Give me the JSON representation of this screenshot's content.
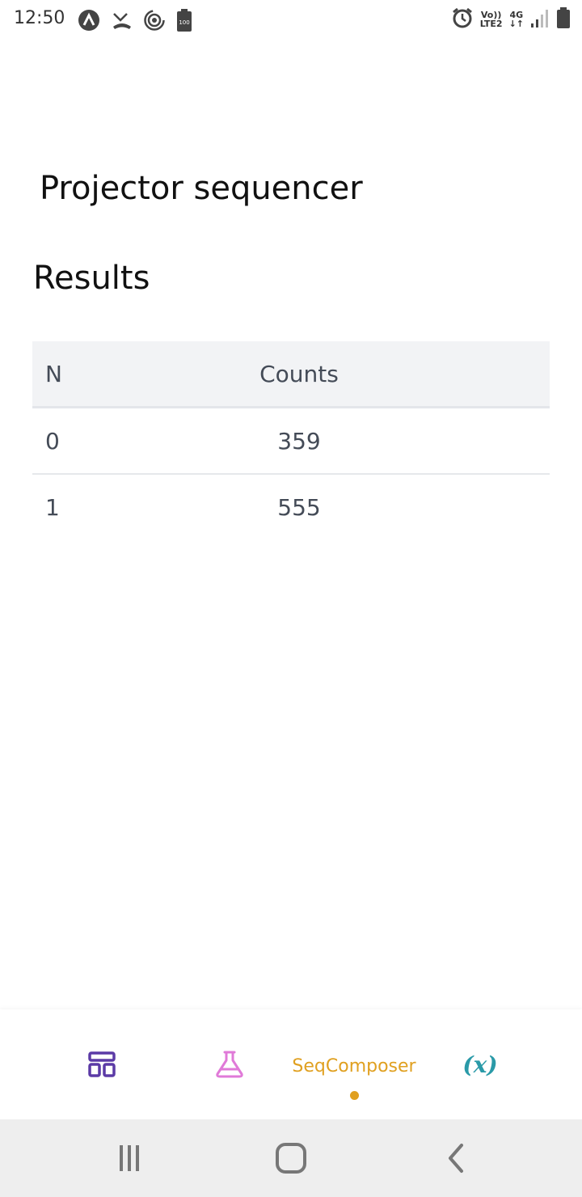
{
  "status_bar": {
    "time": "12:50",
    "network_top": "Vo))",
    "network_bottom": "LTE2",
    "network_type": "4G",
    "battery_badge": "100"
  },
  "page": {
    "title": "Projector sequencer",
    "section_title": "Results"
  },
  "results_table": {
    "columns": [
      "N",
      "Counts"
    ],
    "rows": [
      {
        "n": "0",
        "counts": "359"
      },
      {
        "n": "1",
        "counts": "555"
      }
    ]
  },
  "bottom_nav": {
    "items": [
      {
        "icon": "dashboard-icon",
        "label": ""
      },
      {
        "icon": "flask-icon",
        "label": ""
      },
      {
        "icon": "",
        "label": "SeqComposer"
      },
      {
        "icon": "variable-icon",
        "label": "(x)"
      }
    ],
    "active_color": "#e0a020"
  },
  "colors": {
    "dashboard_icon": "#5b3aa6",
    "flask_icon": "#e07ad8",
    "variable_icon": "#2a9aa8",
    "header_bg": "#f2f3f5"
  }
}
